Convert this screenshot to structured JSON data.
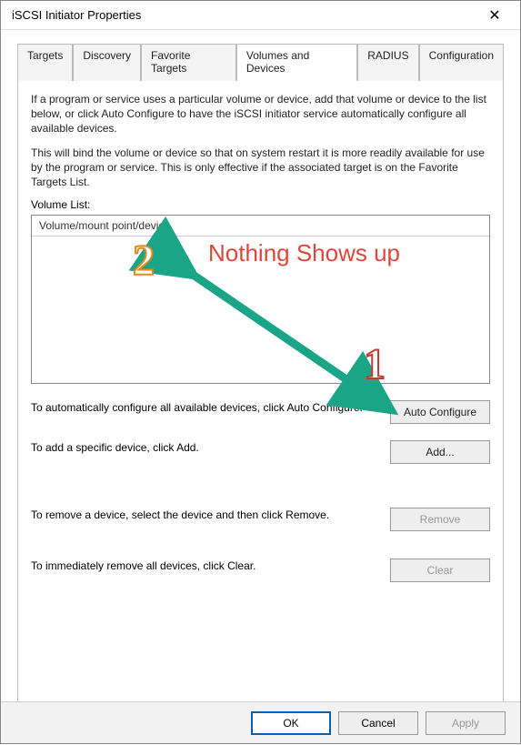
{
  "window": {
    "title": "iSCSI Initiator Properties",
    "close_glyph": "✕"
  },
  "tabs": {
    "targets": "Targets",
    "discovery": "Discovery",
    "favorite": "Favorite Targets",
    "volumes": "Volumes and Devices",
    "radius": "RADIUS",
    "config": "Configuration"
  },
  "body": {
    "intro1": "If a program or service uses a particular volume or device, add that volume or device to the list below, or click Auto Configure to have the iSCSI initiator service automatically configure all available devices.",
    "intro2": "This will bind the volume or device so that on system restart it is more readily available for use by the program or service.  This is only effective if the associated target is on the Favorite Targets List.",
    "volume_list_label": "Volume List:",
    "list_header": "Volume/mount point/device",
    "auto_text": "To automatically configure all available devices, click Auto Configure.",
    "auto_btn": "Auto Configure",
    "add_text": "To add a specific device, click Add.",
    "add_btn": "Add...",
    "remove_text": "To remove a device, select the device and then click Remove.",
    "remove_btn": "Remove",
    "clear_text": "To immediately remove all devices, click Clear.",
    "clear_btn": "Clear"
  },
  "buttons": {
    "ok": "OK",
    "cancel": "Cancel",
    "apply": "Apply"
  },
  "annotation": {
    "marker1": "1",
    "marker2": "2",
    "note": "Nothing Shows up",
    "arrow_color": "#1aa587"
  }
}
